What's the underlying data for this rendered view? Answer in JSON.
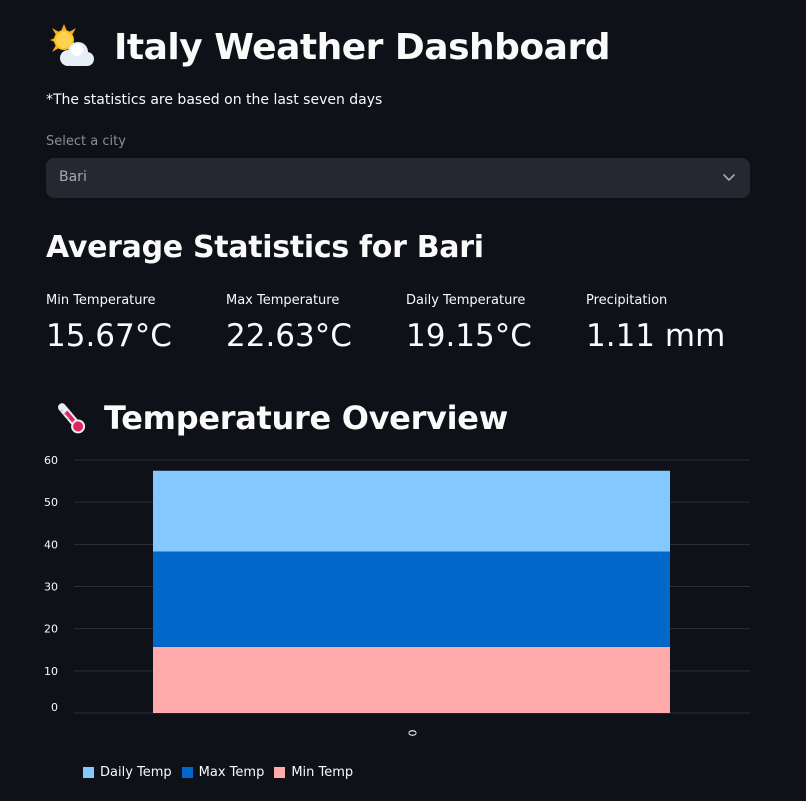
{
  "header": {
    "title": "Italy Weather Dashboard",
    "icon": "sun-behind-cloud-icon"
  },
  "note": "*The statistics are based on the last seven days",
  "city_select": {
    "label": "Select a city",
    "value": "Bari"
  },
  "stats": {
    "heading": "Average Statistics for Bari",
    "metrics": [
      {
        "label": "Min Temperature",
        "value": "15.67°C"
      },
      {
        "label": "Max Temperature",
        "value": "22.63°C"
      },
      {
        "label": "Daily Temperature",
        "value": "19.15°C"
      },
      {
        "label": "Precipitation",
        "value": "1.11 mm"
      }
    ]
  },
  "overview": {
    "heading": "Temperature Overview",
    "icon": "thermometer-icon"
  },
  "chart_data": {
    "type": "bar",
    "stacked": true,
    "categories": [
      "0"
    ],
    "ylim": [
      0,
      60
    ],
    "yticks": [
      0,
      10,
      20,
      30,
      40,
      50,
      60
    ],
    "grid": true,
    "legend_position": "bottom-left",
    "series": [
      {
        "name": "Min Temp",
        "values": [
          15.67
        ],
        "color": "#ffabab"
      },
      {
        "name": "Max Temp",
        "values": [
          22.63
        ],
        "color": "#0068c9"
      },
      {
        "name": "Daily Temp",
        "values": [
          19.15
        ],
        "color": "#83c9ff"
      }
    ],
    "legend_order": [
      "Daily Temp",
      "Max Temp",
      "Min Temp"
    ]
  },
  "colors": {
    "background": "#0e1117",
    "select_bg": "#262730",
    "text": "#fafafa",
    "muted": "#8b8d95"
  }
}
